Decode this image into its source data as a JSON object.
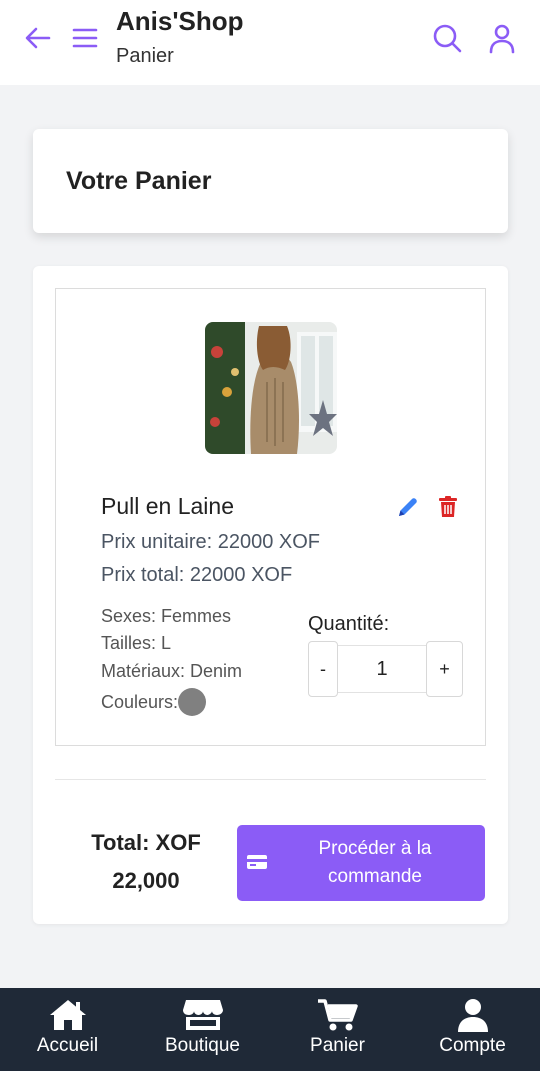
{
  "appbar": {
    "title": "Anis'Shop",
    "subtitle": "Panier",
    "icons": [
      "back-arrow-icon",
      "menu-icon",
      "search-icon",
      "user-icon"
    ],
    "accent_color": "#8b5cf6"
  },
  "page": {
    "heading": "Votre Panier"
  },
  "cart": {
    "items": [
      {
        "name": "Pull en Laine",
        "unit_price": "Prix unitaire: 22000 XOF",
        "total_price": "Prix total: 22000 XOF",
        "sexes": "Sexes: Femmes",
        "sizes": "Tailles: L",
        "materials": "Matériaux: Denim",
        "colors_label": "Couleurs:",
        "color_swatch": "#808080",
        "quantity_label": "Quantité:",
        "quantity": "1",
        "minus": "-",
        "plus": "+"
      }
    ],
    "total_label": "Total: XOF",
    "total_value": "22,000",
    "checkout_label": "Procéder à la commande"
  },
  "bottom_nav": {
    "items": [
      {
        "label": "Accueil",
        "icon": "home-icon"
      },
      {
        "label": "Boutique",
        "icon": "store-icon"
      },
      {
        "label": "Panier",
        "icon": "cart-icon"
      },
      {
        "label": "Compte",
        "icon": "account-icon"
      }
    ],
    "background": "#1f2937"
  }
}
